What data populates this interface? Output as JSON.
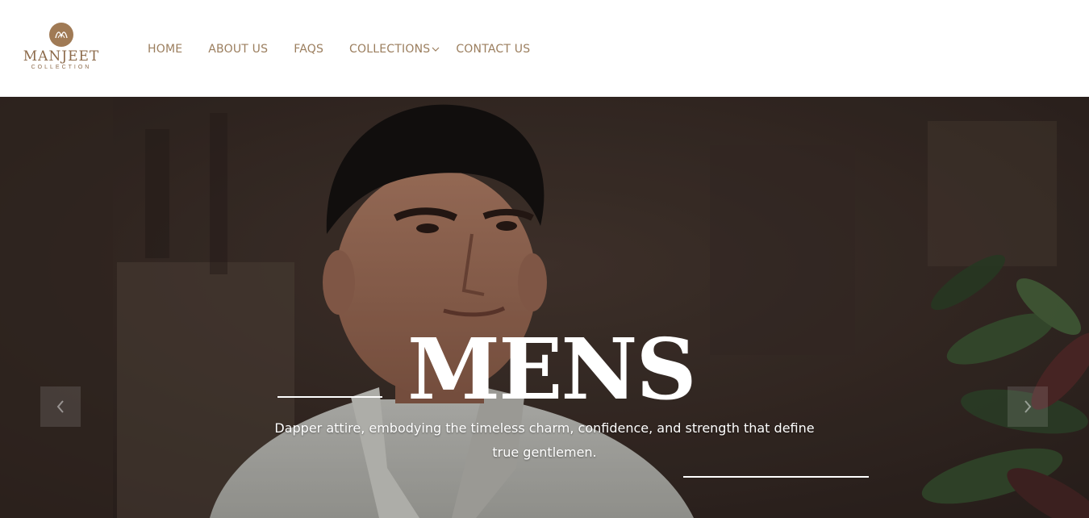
{
  "brand": {
    "name": "MANJEET",
    "sub": "COLLECTION",
    "color": "#a07a55"
  },
  "nav": {
    "home": "HOME",
    "about": "ABOUT US",
    "faqs": "FAQS",
    "collections": "COLLECTIONS",
    "contact": "CONTACT US",
    "text_color": "#9b7e5e"
  },
  "hero": {
    "title": "MENS",
    "caption": "Dapper attire, embodying the timeless charm, confidence, and strength that define true gentlemen.",
    "prev_icon": "chevron-left-icon",
    "next_icon": "chevron-right-icon"
  }
}
